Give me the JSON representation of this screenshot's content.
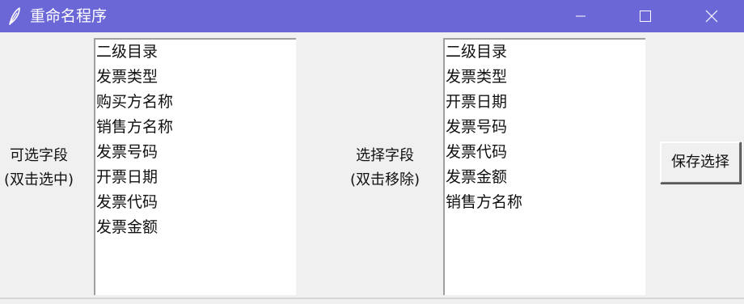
{
  "window": {
    "title": "重命名程序",
    "app_icon": "feather-icon",
    "titlebar_color": "#6b67d6",
    "controls": {
      "minimize_icon": "minimize-icon",
      "maximize_icon": "maximize-icon",
      "close_icon": "close-icon"
    }
  },
  "available": {
    "label_line1": "可选字段",
    "label_line2": "(双击选中)",
    "items": [
      "二级目录",
      "发票类型",
      "购买方名称",
      "销售方名称",
      "发票号码",
      "开票日期",
      "发票代码",
      "发票金额"
    ]
  },
  "selected": {
    "label_line1": "选择字段",
    "label_line2": "(双击移除)",
    "items": [
      "二级目录",
      "发票类型",
      "开票日期",
      "发票号码",
      "发票代码",
      "发票金额",
      "销售方名称"
    ]
  },
  "save_button": {
    "label": "保存选择"
  }
}
